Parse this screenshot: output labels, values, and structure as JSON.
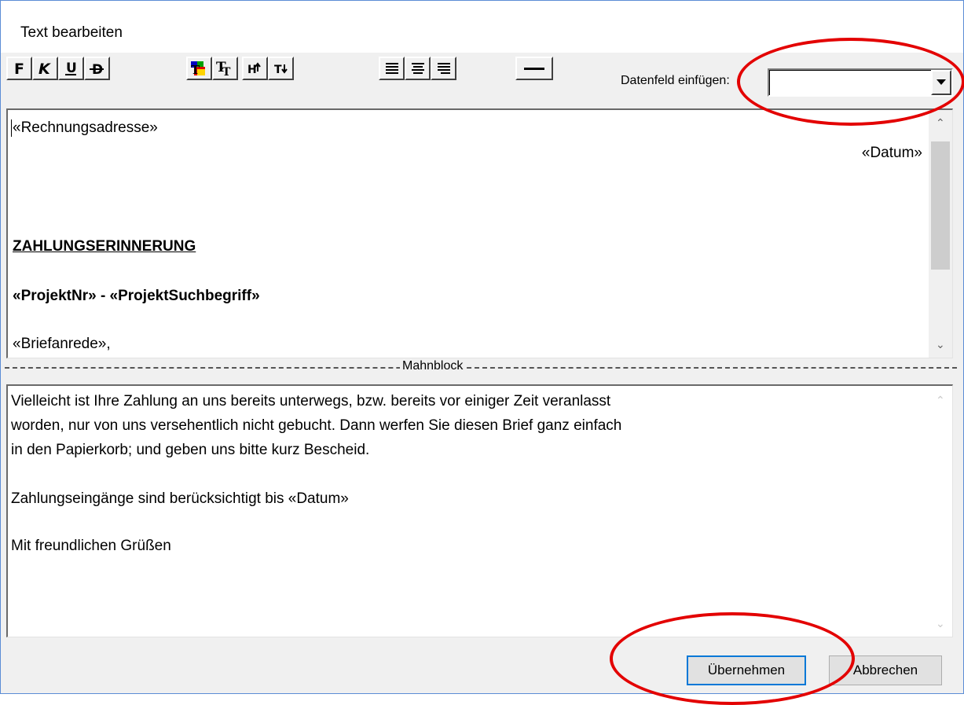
{
  "window": {
    "title": "Text bearbeiten"
  },
  "toolbar": {
    "buttons": [
      {
        "name": "bold",
        "label": "F"
      },
      {
        "name": "italic",
        "label": "K"
      },
      {
        "name": "underline",
        "label": "U"
      },
      {
        "name": "strikethrough",
        "label": "D"
      },
      {
        "name": "text-color",
        "label": ""
      },
      {
        "name": "font",
        "label": "T"
      },
      {
        "name": "superscript",
        "label": "H"
      },
      {
        "name": "subscript",
        "label": "T"
      },
      {
        "name": "align-left",
        "label": ""
      },
      {
        "name": "align-center",
        "label": ""
      },
      {
        "name": "align-right",
        "label": ""
      },
      {
        "name": "horizontal-line",
        "label": ""
      }
    ],
    "datafield_label": "Datenfeld einfügen:",
    "datafield_value": ""
  },
  "editor_top": {
    "lines": [
      "«Rechnungsadresse»",
      "«Datum»",
      "ZAHLUNGSERINNERUNG",
      "«ProjektNr» - «ProjektSuchbegriff»",
      "«Briefanrede»,"
    ]
  },
  "divider_label": "Mahnblock",
  "editor_bottom": {
    "lines": [
      "Vielleicht ist Ihre Zahlung an uns bereits unterwegs, bzw. bereits vor einiger Zeit veranlasst",
      "worden, nur von uns versehentlich nicht gebucht. Dann werfen Sie diesen Brief ganz einfach",
      "in den Papierkorb; und geben uns bitte kurz Bescheid.",
      "Zahlungseingänge sind berücksichtigt bis «Datum»",
      "Mit freundlichen Grüßen"
    ]
  },
  "buttons": {
    "apply": "Übernehmen",
    "cancel": "Abbrechen"
  },
  "colors": {
    "highlight_ring": "#e30000"
  }
}
